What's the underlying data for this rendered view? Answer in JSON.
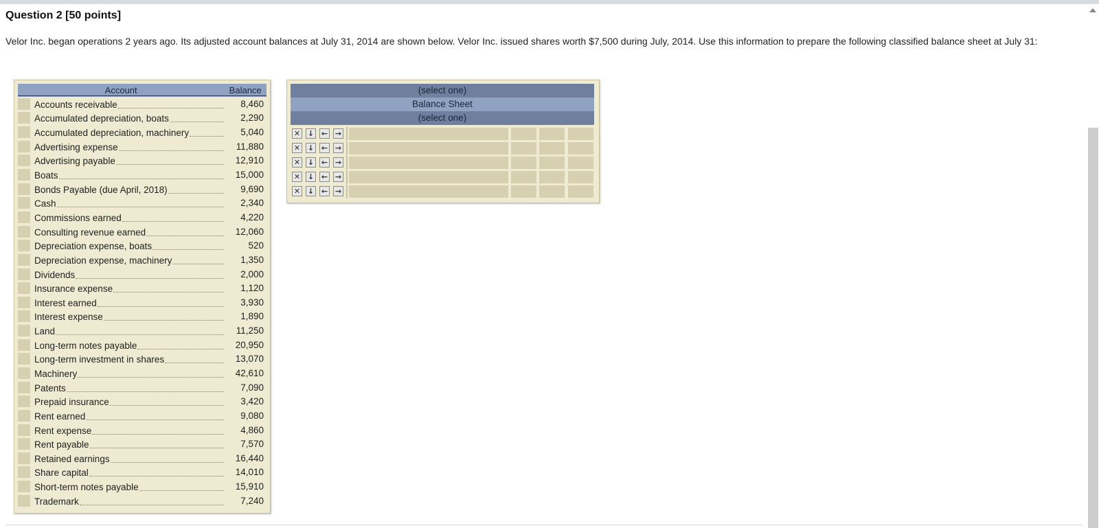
{
  "question": {
    "title": "Question 2 [50 points]",
    "instructions": "Velor Inc. began operations 2 years ago. Its adjusted account balances at July 31, 2014 are shown below. Velor Inc. issued shares worth $7,500 during July, 2014. Use this information to prepare the following classified balance sheet at July 31:"
  },
  "accounts_table": {
    "header_account": "Account",
    "header_balance": "Balance",
    "rows": [
      {
        "name": "Accounts receivable",
        "balance": "8,460"
      },
      {
        "name": "Accumulated depreciation, boats",
        "balance": "2,290"
      },
      {
        "name": "Accumulated depreciation, machinery",
        "balance": "5,040"
      },
      {
        "name": "Advertising expense",
        "balance": "11,880"
      },
      {
        "name": "Advertising payable",
        "balance": "12,910"
      },
      {
        "name": "Boats",
        "balance": "15,000"
      },
      {
        "name": "Bonds Payable  (due April, 2018)",
        "balance": "9,690"
      },
      {
        "name": "Cash",
        "balance": "2,340"
      },
      {
        "name": "Commissions earned",
        "balance": "4,220"
      },
      {
        "name": "Consulting revenue earned",
        "balance": "12,060"
      },
      {
        "name": "Depreciation expense, boats",
        "balance": "520"
      },
      {
        "name": "Depreciation expense, machinery",
        "balance": "1,350"
      },
      {
        "name": "Dividends",
        "balance": "2,000"
      },
      {
        "name": "Insurance expense",
        "balance": "1,120"
      },
      {
        "name": "Interest earned",
        "balance": "3,930"
      },
      {
        "name": "Interest expense",
        "balance": "1,890"
      },
      {
        "name": "Land",
        "balance": "11,250"
      },
      {
        "name": "Long-term notes payable",
        "balance": "20,950"
      },
      {
        "name": "Long-term investment in shares",
        "balance": "13,070"
      },
      {
        "name": "Machinery",
        "balance": "42,610"
      },
      {
        "name": "Patents",
        "balance": "7,090"
      },
      {
        "name": "Prepaid insurance",
        "balance": "3,420"
      },
      {
        "name": "Rent earned",
        "balance": "9,080"
      },
      {
        "name": "Rent expense",
        "balance": "4,860"
      },
      {
        "name": "Rent payable",
        "balance": "7,570"
      },
      {
        "name": "Retained earnings",
        "balance": "16,440"
      },
      {
        "name": "Share capital",
        "balance": "14,010"
      },
      {
        "name": "Short-term notes payable",
        "balance": "15,910"
      },
      {
        "name": "Trademark",
        "balance": "7,240"
      }
    ]
  },
  "balance_sheet": {
    "header_company_select": "(select one)",
    "header_title": "Balance Sheet",
    "header_date_select": "(select one)",
    "row_buttons": {
      "delete": "✕",
      "move_down": "↓",
      "outdent": "←",
      "indent": "→"
    },
    "row_count": 5
  },
  "icons": {
    "delete_row": "close-icon",
    "move_down": "arrow-down-icon",
    "outdent": "arrow-left-icon",
    "indent": "arrow-right-icon"
  },
  "colors": {
    "panel_bg": "#efebd2",
    "header_dark": "#717f9f",
    "header_light": "#8fa2c2",
    "input_cell": "#d6d0b0"
  }
}
